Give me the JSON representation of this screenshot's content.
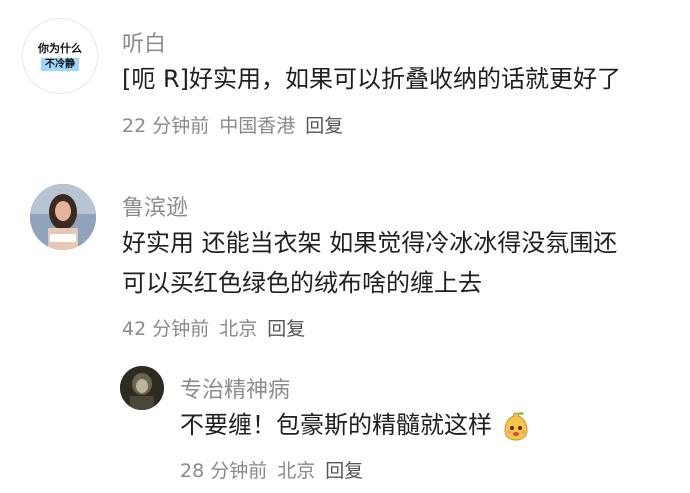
{
  "comments": [
    {
      "avatar_text_line1": "你为什么",
      "avatar_text_line2": "不冷静",
      "username": "听白",
      "text_lines": [
        "[呃 R]好实用，如果可以折叠收纳的话就更好了"
      ],
      "time": "22 分钟前",
      "location": "中国香港",
      "reply": "回复"
    },
    {
      "username": "鲁滨逊",
      "text_lines": [
        "好实用 还能当衣架 如果觉得冷冰冰得没氛围还",
        "可以买红色绿色的绒布啥的缠上去"
      ],
      "time": "42 分钟前",
      "location": "北京",
      "reply": "回复"
    },
    {
      "username": "专治精神病",
      "text_lines": [
        "不要缠！包豪斯的精髓就这样"
      ],
      "emoji": "pear-face-emoji",
      "time": "28 分钟前",
      "location": "北京",
      "reply": "回复"
    }
  ],
  "colors": {
    "name": "#8c8c8c",
    "text": "#1f1f1f",
    "meta": "#8a8a8a",
    "avatar_badge": "#9fd6ff"
  }
}
